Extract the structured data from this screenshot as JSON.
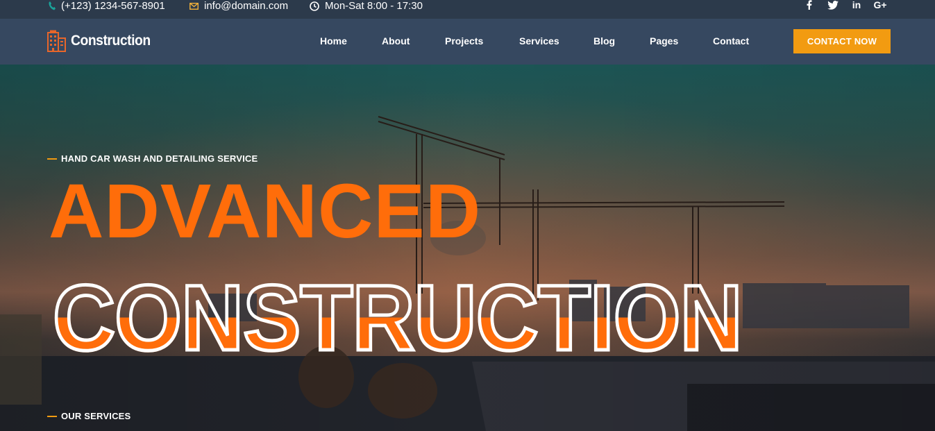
{
  "topbar": {
    "phone": "(+123) 1234-567-8901",
    "email": "info@domain.com",
    "hours": "Mon-Sat 8:00 - 17:30",
    "social": [
      {
        "name": "facebook-icon",
        "glyph": "f"
      },
      {
        "name": "twitter-icon",
        "glyph": "t"
      },
      {
        "name": "linkedin-icon",
        "glyph": "in"
      },
      {
        "name": "google-plus-icon",
        "glyph": "G+"
      }
    ]
  },
  "nav": {
    "brand": "Construction",
    "items": [
      "Home",
      "About",
      "Projects",
      "Services",
      "Blog",
      "Pages",
      "Contact"
    ],
    "cta": "CONTACT NOW"
  },
  "hero": {
    "eyebrow": "HAND CAR WASH AND DETAILING SERVICE",
    "title_line1": "ADVANCED",
    "title_line2": "CONSTRUCTION",
    "section_label": "OUR SERVICES"
  },
  "colors": {
    "accent": "#f29b11",
    "headline": "#ff6d0a",
    "topbar_bg": "#2c3a4b",
    "nav_bg": "#364860"
  }
}
